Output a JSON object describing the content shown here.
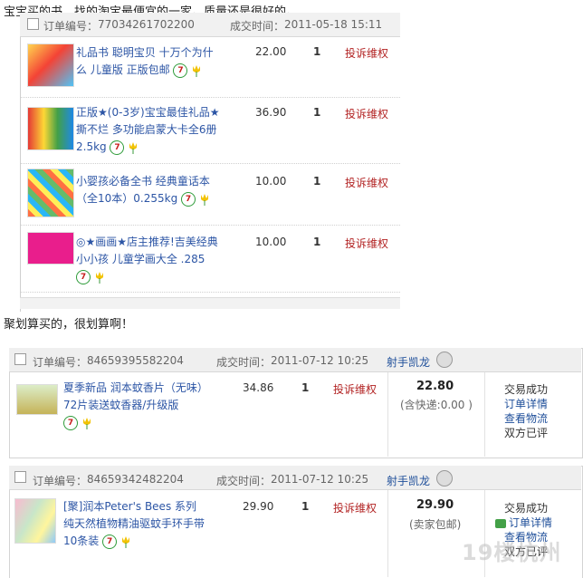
{
  "section1": {
    "caption": "宝宝买的书，找的淘宝最便宜的一家。质量还是很好的。",
    "order": {
      "id_label": "订单编号：",
      "id_value": "77034261702200",
      "time_label": "成交时间：",
      "time_value": "2011-05-18 15:11",
      "items": [
        {
          "title": "礼品书 聪明宝贝 十万个为什么 儿童版 正版包邮",
          "price": "22.00",
          "qty": "1",
          "action": "投诉维权"
        },
        {
          "title": "正版★(0-3岁)宝宝最佳礼品★撕不烂 多功能启蒙大卡全6册2.5kg",
          "price": "36.90",
          "qty": "1",
          "action": "投诉维权"
        },
        {
          "title": "小婴孩必备全书 经典童话本（全10本）0.255kg",
          "price": "10.00",
          "qty": "1",
          "action": "投诉维权"
        },
        {
          "title": "◎★画画★店主推荐!吉美经典 小小孩 儿童学画大全 .285",
          "price": "10.00",
          "qty": "1",
          "action": "投诉维权"
        }
      ]
    }
  },
  "section2": {
    "caption": "聚划算买的，很划算啊！",
    "orders": [
      {
        "id_label": "订单编号：",
        "id_value": "84659395582204",
        "time_label": "成交时间：",
        "time_value": "2011-07-12 10:25",
        "seller": "射手凯龙",
        "item_title": "夏季新品 润本蚊香片（无味）72片装送蚊香器/升级版",
        "price": "34.86",
        "qty": "1",
        "action": "投诉维权",
        "total": "22.80",
        "shipping": "(含快递:0.00 )",
        "status": "交易成功",
        "links": [
          "订单详情",
          "查看物流",
          "双方已评"
        ]
      },
      {
        "id_label": "订单编号：",
        "id_value": "84659342482204",
        "time_label": "成交时间：",
        "time_value": "2011-07-12 10:25",
        "seller": "射手凯龙",
        "item_title": "[聚]润本Peter's Bees 系列 纯天然植物精油驱蚊手环手带10条装",
        "price": "29.90",
        "qty": "1",
        "action": "投诉维权",
        "total": "29.90",
        "shipping": "(卖家包邮)",
        "status": "交易成功",
        "links": [
          "订单详情",
          "查看物流",
          "双方已评"
        ]
      }
    ]
  },
  "badge_text": "7",
  "watermark": "19楼杭州"
}
